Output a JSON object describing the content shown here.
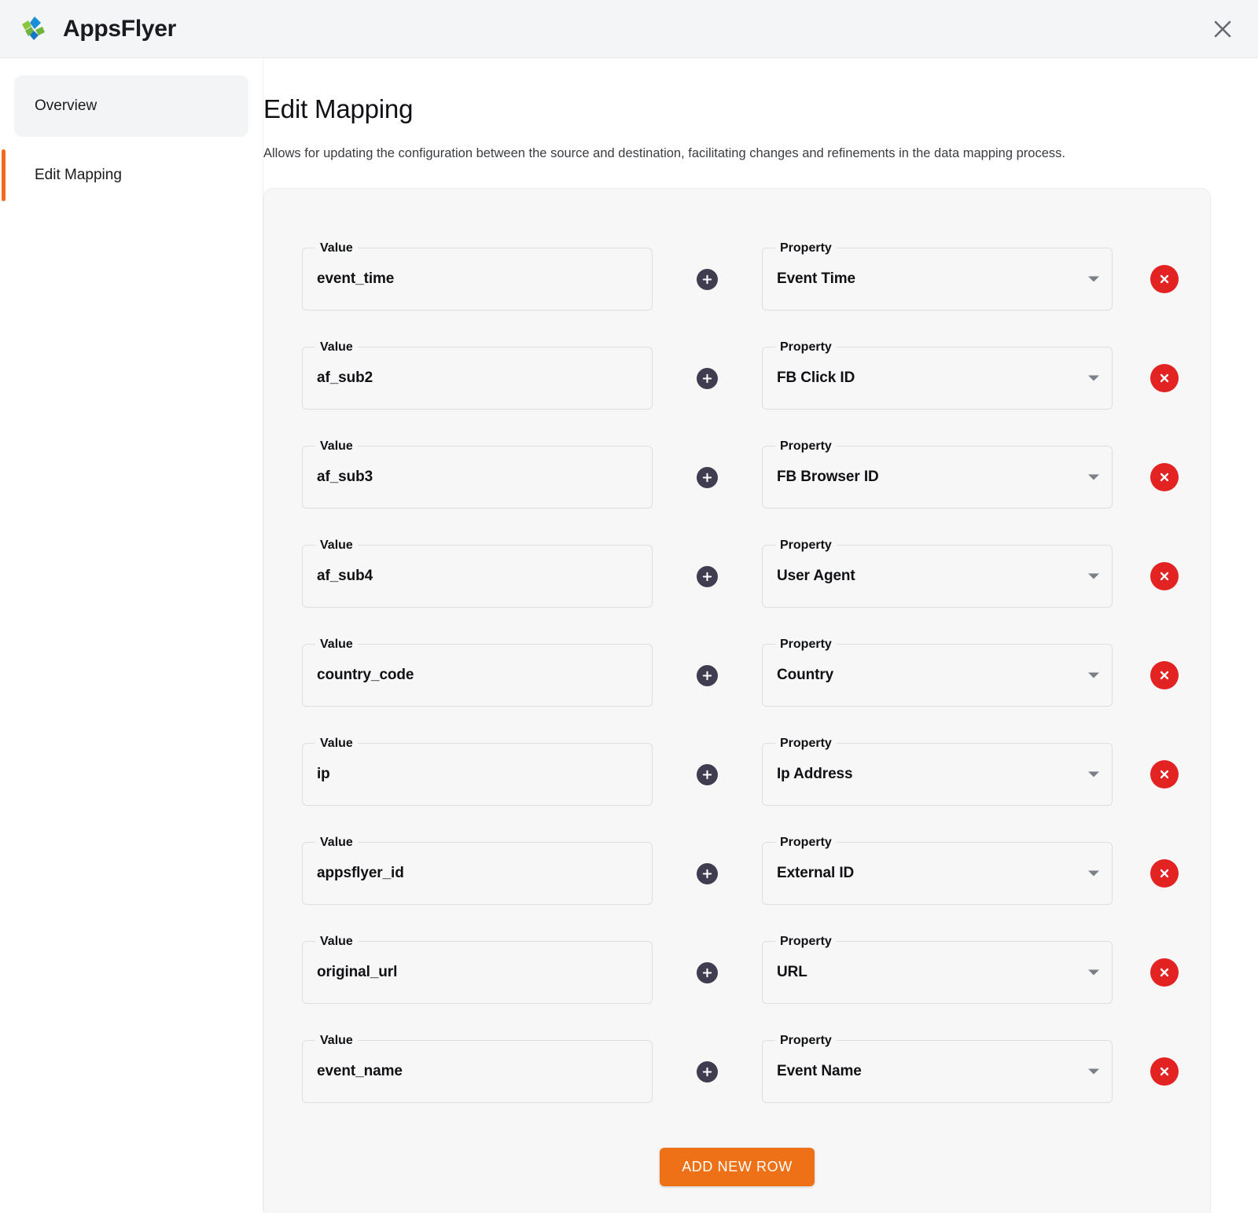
{
  "app": {
    "brand_name": "AppsFlyer",
    "logo_icon": "appsflyer-logo-icon",
    "close_icon": "close-icon"
  },
  "sidebar": {
    "items": [
      {
        "label": "Overview",
        "state": "hover"
      },
      {
        "label": "Edit Mapping",
        "state": "active"
      }
    ]
  },
  "main": {
    "title": "Edit Mapping",
    "description": "Allows for updating the configuration between the source and destination, facilitating changes and refinements in the data mapping process."
  },
  "form": {
    "value_label": "Value",
    "property_label": "Property",
    "add_icon": "plus-icon",
    "delete_icon": "close-circle-icon",
    "dropdown_icon": "chevron-down-icon",
    "rows": [
      {
        "value": "event_time",
        "property": "Event Time"
      },
      {
        "value": "af_sub2",
        "property": "FB Click ID"
      },
      {
        "value": "af_sub3",
        "property": "FB Browser ID"
      },
      {
        "value": "af_sub4",
        "property": "User Agent"
      },
      {
        "value": "country_code",
        "property": "Country"
      },
      {
        "value": "ip",
        "property": "Ip Address"
      },
      {
        "value": "appsflyer_id",
        "property": "External ID"
      },
      {
        "value": "original_url",
        "property": "URL"
      },
      {
        "value": "event_name",
        "property": "Event Name"
      }
    ]
  },
  "footer": {
    "add_row_label": "ADD NEW ROW"
  },
  "colors": {
    "accent_orange": "#ee7117",
    "delete_red": "#e32222",
    "add_dark": "#3f3d4f",
    "panel_bg": "#f7f7f8",
    "header_bg": "#f4f5f7",
    "logo_green": "#7ab648",
    "logo_blue": "#1a8dd8"
  }
}
